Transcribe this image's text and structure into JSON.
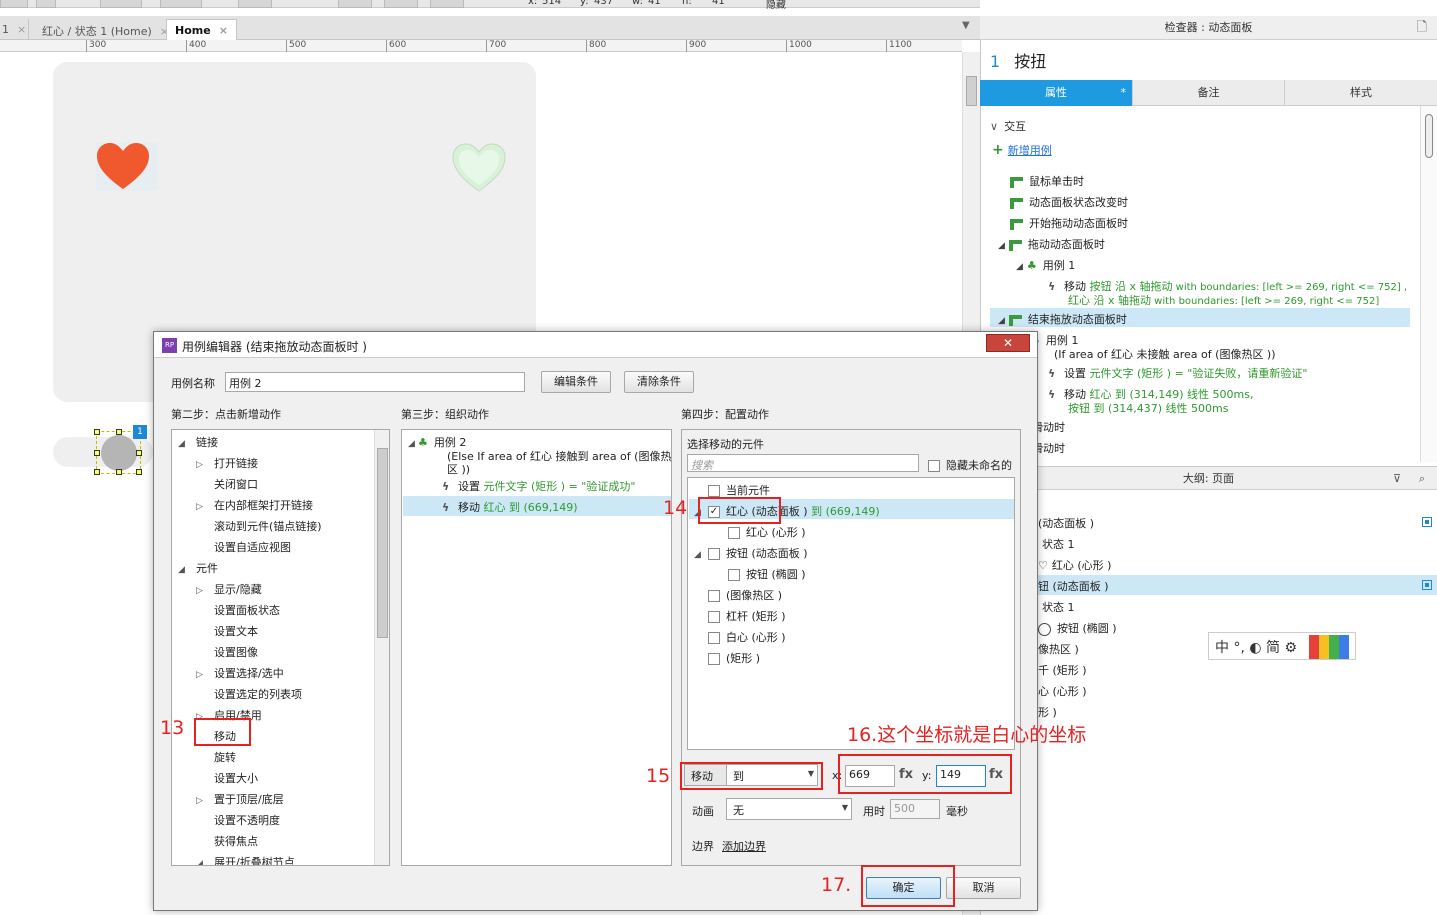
{
  "toolbar": {
    "x_label": "x:",
    "x_value": "514",
    "y_label": "y:",
    "y_value": "437",
    "w_label": "w:",
    "w_value": "41",
    "h_label": "h:",
    "h_value": "41",
    "hide_label": "隐藏"
  },
  "tabs": [
    {
      "label": "1"
    },
    {
      "label": "红心 / 状态 1 (Home)"
    },
    {
      "label": "Home"
    }
  ],
  "tab_close": "×",
  "ruler": [
    "300",
    "400",
    "500",
    "600",
    "700",
    "800",
    "900",
    "1000",
    "1100"
  ],
  "canvas": {
    "knob_badge": "1"
  },
  "inspector": {
    "title": "检查器 : 动态面板",
    "index": "1",
    "name": "按扭",
    "tabs": [
      "属性",
      "备注",
      "样式"
    ],
    "tab_marker": "*",
    "section": "交互",
    "add_case": "新增用例",
    "events": [
      "鼠标单击时",
      "动态面板状态改变时",
      "开始拖动动态面板时",
      "拖动动态面板时"
    ],
    "case1": "用例 1",
    "case1_action_line1": {
      "prefix": "移动",
      "target": "按钮 沿 x 轴拖动",
      "rest": " with boundaries: [left >= 269, right <= 752] ,"
    },
    "case1_action_line2": {
      "target": "红心 沿 x 轴拖动",
      "rest": " with boundaries: [left >= 269, right <= 752]"
    },
    "drop_event": "结束拖放动态面板时",
    "drop_case": "用例 1",
    "drop_case_cond": "(If area of 红心 未接触  area of (图像热区 ))",
    "drop_action1": {
      "prefix": "设置",
      "target": "元件文字 (矩形 ) = \"验证失败，请重新验证\""
    },
    "drop_action2_line1": {
      "prefix": "移动",
      "target": "红心 到 (314,149) 线性 500ms,"
    },
    "drop_action2_line2": {
      "target": "按钮 到 (314,437) 线性 500ms"
    },
    "more_events": [
      "向左滑动时",
      "向右滑动时"
    ]
  },
  "outline": {
    "title": "大纲: 页面",
    "items": [
      "(动态面板 )",
      "状态 1",
      "红心 (心形 )",
      "钮 (动态面板 )",
      "状态 1",
      "按钮 (椭圆 )",
      "像热区 )",
      "千 (矩形 )",
      "心 (心形 )",
      "形 )"
    ]
  },
  "ime": {
    "text": "中 °, ◐ 简 ⚙"
  },
  "dialog": {
    "title": "用例编辑器 (结束拖放动态面板时 )",
    "icon": "RP",
    "close": "✕",
    "case_name_label": "用例名称",
    "case_name_value": "用例 2",
    "edit_condition": "编辑条件",
    "clear_condition": "清除条件",
    "step2": "第二步：点击新增动作",
    "step3": "第三步：组织动作",
    "step4": "第四步：配置动作",
    "actions": [
      {
        "label": "链接",
        "level": 0,
        "exp": "◢"
      },
      {
        "label": "打开链接",
        "level": 1,
        "exp": "▷"
      },
      {
        "label": "关闭窗口",
        "level": 1,
        "exp": ""
      },
      {
        "label": "在内部框架打开链接",
        "level": 1,
        "exp": "▷"
      },
      {
        "label": "滚动到元件(锚点链接)",
        "level": 1,
        "exp": ""
      },
      {
        "label": "设置自适应视图",
        "level": 1,
        "exp": ""
      },
      {
        "label": "元件",
        "level": 0,
        "exp": "◢"
      },
      {
        "label": "显示/隐藏",
        "level": 1,
        "exp": "▷"
      },
      {
        "label": "设置面板状态",
        "level": 1,
        "exp": ""
      },
      {
        "label": "设置文本",
        "level": 1,
        "exp": ""
      },
      {
        "label": "设置图像",
        "level": 1,
        "exp": ""
      },
      {
        "label": "设置选择/选中",
        "level": 1,
        "exp": "▷"
      },
      {
        "label": "设置选定的列表项",
        "level": 1,
        "exp": ""
      },
      {
        "label": "启用/禁用",
        "level": 1,
        "exp": "▷"
      },
      {
        "label": "移动",
        "level": 1,
        "exp": ""
      },
      {
        "label": "旋转",
        "level": 1,
        "exp": ""
      },
      {
        "label": "设置大小",
        "level": 1,
        "exp": ""
      },
      {
        "label": "置于顶层/底层",
        "level": 1,
        "exp": "▷"
      },
      {
        "label": "设置不透明度",
        "level": 1,
        "exp": ""
      },
      {
        "label": "获得焦点",
        "level": 1,
        "exp": ""
      },
      {
        "label": "展开/折叠树节点",
        "level": 1,
        "exp": "◢"
      }
    ],
    "organize": {
      "case": "用例 2",
      "cond_line1": "(Else If area of 红心 接触到  area of (图像热",
      "cond_line2": "区 ))",
      "act1_prefix": "设置",
      "act1_target": "元件文字 (矩形 ) = \"验证成功\"",
      "act2_prefix": "移动",
      "act2_target": "红心 到 (669,149)"
    },
    "config": {
      "choose_label": "选择移动的元件",
      "search_placeholder": "搜索",
      "hide_unnamed": "隐藏未命名的",
      "widgets": [
        {
          "label": "当前元件",
          "level": 0,
          "checked": false,
          "exp": ""
        },
        {
          "label": "红心 (动态面板 )",
          "extra": " 到 (669,149)",
          "level": 0,
          "checked": true,
          "exp": "◢"
        },
        {
          "label": "红心 (心形 )",
          "level": 1,
          "checked": false,
          "exp": ""
        },
        {
          "label": "按钮 (动态面板 )",
          "level": 0,
          "checked": false,
          "exp": "◢"
        },
        {
          "label": "按钮 (椭圆 )",
          "level": 1,
          "checked": false,
          "exp": ""
        },
        {
          "label": "(图像热区 )",
          "level": 0,
          "checked": false,
          "exp": ""
        },
        {
          "label": "杠杆 (矩形 )",
          "level": 0,
          "checked": false,
          "exp": ""
        },
        {
          "label": "白心 (心形 )",
          "level": 0,
          "checked": false,
          "exp": ""
        },
        {
          "label": "(矩形 )",
          "level": 0,
          "checked": false,
          "exp": ""
        }
      ],
      "move_label": "移动",
      "move_mode": "到",
      "x_label": "x:",
      "x_value": "669",
      "y_label": "y:",
      "y_value": "149",
      "fx": "fx",
      "anim_label": "动画",
      "anim_value": "无",
      "time_label": "用时",
      "time_value": "500",
      "ms_label": "毫秒",
      "bound_label": "边界",
      "add_bound": "添加边界"
    },
    "ok": "确定",
    "cancel": "取消"
  },
  "annotations": {
    "n13": "13",
    "n14": "14",
    "n15": "15",
    "n16": "16.这个坐标就是白心的坐标",
    "n17": "17."
  },
  "colors": {
    "accent": "#1e9be0",
    "heart": "#f0582d",
    "annotation": "#e52222",
    "green_text": "#2e9a2e"
  }
}
